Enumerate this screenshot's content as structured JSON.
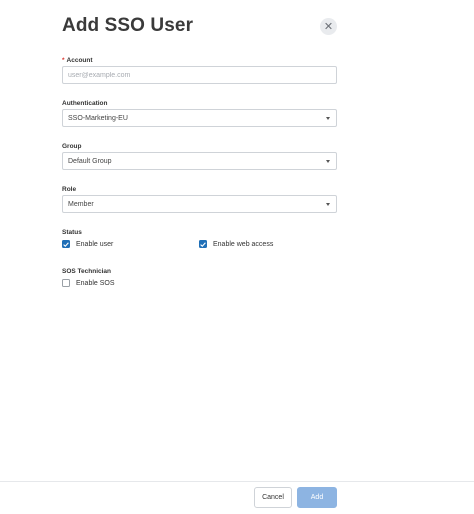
{
  "dialog": {
    "title": "Add SSO User",
    "close_symbol": "✕"
  },
  "account": {
    "label": "Account",
    "required_marker": "*",
    "placeholder": "user@example.com",
    "value": ""
  },
  "authentication": {
    "label": "Authentication",
    "selected": "SSO-Marketing-EU"
  },
  "group": {
    "label": "Group",
    "selected": "Default Group"
  },
  "role": {
    "label": "Role",
    "selected": "Member"
  },
  "status": {
    "label": "Status",
    "enable_user": {
      "label": "Enable user",
      "checked": true
    },
    "enable_web_access": {
      "label": "Enable web access",
      "checked": true
    }
  },
  "sos_technician": {
    "label": "SOS Technician",
    "enable_sos": {
      "label": "Enable SOS",
      "checked": false
    }
  },
  "footer": {
    "cancel_label": "Cancel",
    "add_label": "Add"
  },
  "colors": {
    "accent": "#1f6fb7",
    "add_button_disabled": "#8db4e2",
    "required": "#d9342b"
  }
}
